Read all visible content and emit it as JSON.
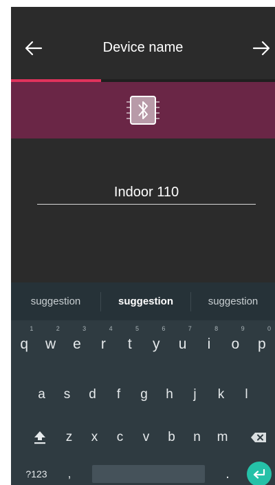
{
  "header": {
    "title": "Device name",
    "back_icon": "arrow-left-icon",
    "next_icon": "arrow-right-icon"
  },
  "progress": {
    "fraction": 0.34,
    "color": "#e0335c"
  },
  "banner": {
    "icon": "bluetooth-chip-icon",
    "color": "#6a2646"
  },
  "device_name_input": {
    "value": "Indoor 110"
  },
  "keyboard": {
    "suggestions": [
      "suggestion",
      "suggestion",
      "suggestion"
    ],
    "row1": [
      {
        "label": "q",
        "hint": "1"
      },
      {
        "label": "w",
        "hint": "2"
      },
      {
        "label": "e",
        "hint": "3"
      },
      {
        "label": "r",
        "hint": "4"
      },
      {
        "label": "t",
        "hint": "5"
      },
      {
        "label": "y",
        "hint": "6"
      },
      {
        "label": "u",
        "hint": "7"
      },
      {
        "label": "i",
        "hint": "8"
      },
      {
        "label": "o",
        "hint": "9"
      },
      {
        "label": "p",
        "hint": "0"
      }
    ],
    "row2": [
      "a",
      "s",
      "d",
      "f",
      "g",
      "h",
      "j",
      "k",
      "l"
    ],
    "row3": [
      "z",
      "x",
      "c",
      "v",
      "b",
      "n",
      "m"
    ],
    "shift_icon": "shift-icon",
    "backspace_icon": "backspace-icon",
    "symbols_label": "?123",
    "comma_label": ",",
    "period_label": ".",
    "enter_icon": "enter-icon",
    "enter_color": "#25c1a8"
  }
}
